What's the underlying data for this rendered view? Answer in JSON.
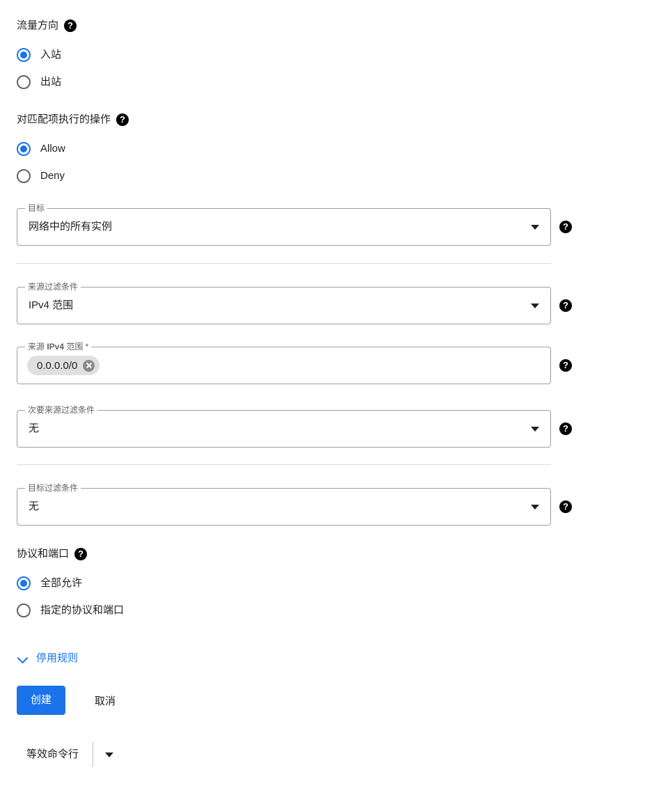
{
  "traffic_direction": {
    "label": "流量方向",
    "help_icon": "help-icon",
    "options": [
      {
        "label": "入站",
        "selected": true
      },
      {
        "label": "出站",
        "selected": false
      }
    ]
  },
  "action_on_match": {
    "label": "对匹配项执行的操作",
    "help_icon": "help-icon",
    "options": [
      {
        "label": "Allow",
        "selected": true
      },
      {
        "label": "Deny",
        "selected": false
      }
    ]
  },
  "targets": {
    "legend": "目标",
    "value": "网络中的所有实例",
    "caret_icon": "chevron-down-icon",
    "help_icon": "help-icon"
  },
  "source_filter": {
    "legend": "来源过滤条件",
    "value": "IPv4 范围",
    "caret_icon": "chevron-down-icon",
    "help_icon": "help-icon"
  },
  "source_ipv4_ranges": {
    "legend_prefix": "来源 ",
    "legend_bold": "IPv4",
    "legend_suffix": " 范围 *",
    "chips": [
      {
        "text": "0.0.0.0/0",
        "remove_icon": "close-circle-icon"
      }
    ],
    "help_icon": "help-icon"
  },
  "secondary_source_filter": {
    "legend": "次要来源过滤条件",
    "value": "无",
    "caret_icon": "chevron-down-icon",
    "help_icon": "help-icon"
  },
  "destination_filter": {
    "legend": "目标过滤条件",
    "value": "无",
    "caret_icon": "chevron-down-icon",
    "help_icon": "help-icon"
  },
  "protocols_and_ports": {
    "label": "协议和端口",
    "help_icon": "help-icon",
    "options": [
      {
        "label": "全部允许",
        "selected": true
      },
      {
        "label": "指定的协议和端口",
        "selected": false
      }
    ]
  },
  "disable_rule": {
    "label": "停用规则",
    "chevron_icon": "chevron-down-icon"
  },
  "actions": {
    "create_label": "创建",
    "cancel_label": "取消"
  },
  "equivalent_command_line": {
    "label": "等效命令行",
    "caret_icon": "chevron-down-icon"
  },
  "colors": {
    "accent": "#1a73e8",
    "text": "#202124",
    "muted": "#5f6368",
    "border": "#9aa0a6",
    "divider": "#dadce0",
    "chip_bg": "#e0e0e0"
  }
}
